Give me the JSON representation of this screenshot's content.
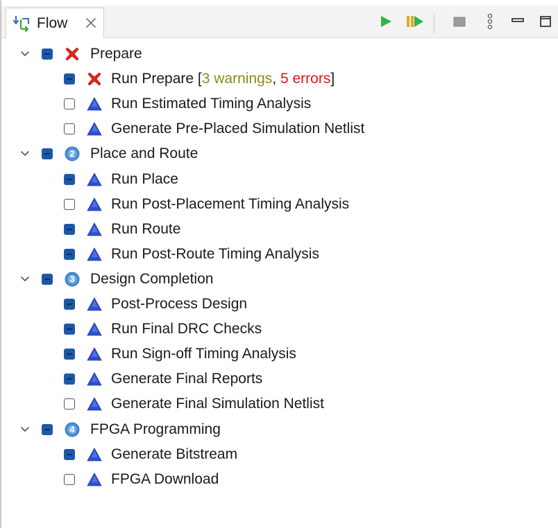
{
  "tab": {
    "title": "Flow"
  },
  "toolbar": {
    "run_icon": "run-icon",
    "run_selected_icon": "run-selected-icon",
    "stop_icon": "stop-icon",
    "view_menu_icon": "view-menu-icon",
    "minimize_icon": "minimize-icon",
    "maximize_icon": "maximize-icon"
  },
  "colors": {
    "checked": "#1c58a8",
    "warning_text": "#8b8b1a",
    "error_text": "#e5141b",
    "task_triangle": "#2f4fd1",
    "step_circle": "#4a8fd8",
    "error_x": "#e0271d"
  },
  "sections": [
    {
      "label": "Prepare",
      "state": "error",
      "step": "",
      "checked": true,
      "tasks": [
        {
          "label": "Run Prepare ",
          "bracket_open": "[",
          "warnings": "3 warnings",
          "comma": ", ",
          "errors": "5 errors",
          "bracket_close": "]",
          "checked": true,
          "state": "error"
        }
      ]
    },
    {
      "label": "Place and Route",
      "state": "step",
      "step": "2",
      "checked": true,
      "tasks": [
        {
          "label": "Run Estimated Timing Analysis",
          "checked": false,
          "state": "pending"
        },
        {
          "label": "Generate Pre-Placed Simulation Netlist",
          "checked": false,
          "state": "pending"
        }
      ]
    }
  ],
  "rows": [
    {
      "kind": "section",
      "label": "Prepare",
      "checked": true,
      "icon": "error-x-icon",
      "step": ""
    },
    {
      "kind": "task",
      "label": "Run Prepare ",
      "checked": true,
      "icon": "error-x-icon",
      "bracket_open": "[",
      "warnings": "3 warnings",
      "comma": ", ",
      "errors": "5 errors",
      "bracket_close": "]"
    },
    {
      "kind": "task",
      "label": "Run Estimated Timing Analysis",
      "checked": false,
      "icon": "task-triangle-icon"
    },
    {
      "kind": "task",
      "label": "Generate Pre-Placed Simulation Netlist",
      "checked": false,
      "icon": "task-triangle-icon"
    },
    {
      "kind": "section",
      "label": "Place and Route",
      "checked": true,
      "icon": "step-2-icon",
      "step": "2"
    },
    {
      "kind": "task",
      "label": "Run Place",
      "checked": true,
      "icon": "task-triangle-icon"
    },
    {
      "kind": "task",
      "label": "Run Post-Placement Timing Analysis",
      "checked": false,
      "icon": "task-triangle-icon"
    },
    {
      "kind": "task",
      "label": "Run Route",
      "checked": true,
      "icon": "task-triangle-icon"
    },
    {
      "kind": "task",
      "label": "Run Post-Route Timing Analysis",
      "checked": true,
      "icon": "task-triangle-icon"
    },
    {
      "kind": "section",
      "label": "Design Completion",
      "checked": true,
      "icon": "step-3-icon",
      "step": "3"
    },
    {
      "kind": "task",
      "label": "Post-Process Design",
      "checked": true,
      "icon": "task-triangle-icon"
    },
    {
      "kind": "task",
      "label": "Run Final DRC Checks",
      "checked": true,
      "icon": "task-triangle-icon"
    },
    {
      "kind": "task",
      "label": "Run Sign-off Timing Analysis",
      "checked": true,
      "icon": "task-triangle-icon"
    },
    {
      "kind": "task",
      "label": "Generate Final Reports",
      "checked": true,
      "icon": "task-triangle-icon"
    },
    {
      "kind": "task",
      "label": "Generate Final Simulation Netlist",
      "checked": false,
      "icon": "task-triangle-icon"
    },
    {
      "kind": "section",
      "label": "FPGA Programming",
      "checked": true,
      "icon": "step-4-icon",
      "step": "4"
    },
    {
      "kind": "task",
      "label": "Generate Bitstream",
      "checked": true,
      "icon": "task-triangle-icon"
    },
    {
      "kind": "task",
      "label": "FPGA Download",
      "checked": false,
      "icon": "task-triangle-icon"
    }
  ]
}
